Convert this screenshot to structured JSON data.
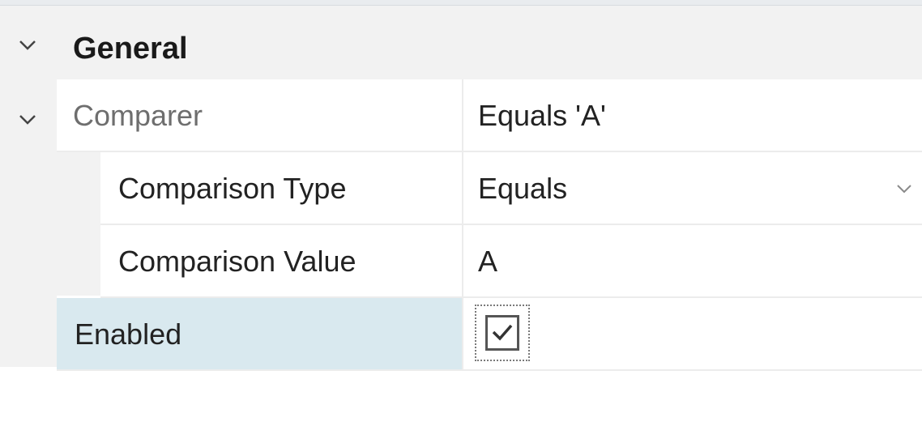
{
  "category": {
    "label": "General",
    "expanded": true,
    "chevron_icon": "chevron-down-icon"
  },
  "properties": [
    {
      "name": "Comparer",
      "value": "Equals 'A'",
      "expandable": true,
      "expanded": true,
      "name_style": "muted",
      "children": [
        {
          "name": "Comparison Type",
          "value": "Equals",
          "editor": "dropdown"
        },
        {
          "name": "Comparison Value",
          "value": "A",
          "editor": "text"
        }
      ]
    },
    {
      "name": "Enabled",
      "checked": true,
      "editor": "checkbox",
      "selected": true
    }
  ],
  "colors": {
    "category_background": "#f2f2f2",
    "selected_row_background": "#d9e9ef",
    "grid_line": "#ececec"
  }
}
